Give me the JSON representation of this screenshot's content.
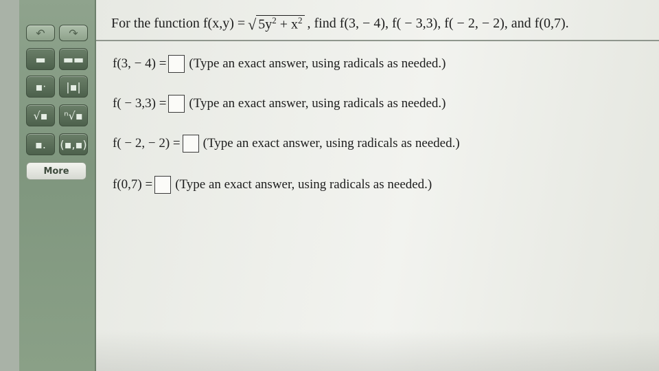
{
  "palette": {
    "rows": [
      [
        "undo-icon",
        "redo-icon"
      ],
      [
        "fraction-icon",
        "mixed-number-icon"
      ],
      [
        "exponent-icon",
        "absolute-value-icon"
      ],
      [
        "square-root-icon",
        "nth-root-icon"
      ],
      [
        "decimal-icon",
        "ordered-pair-icon"
      ]
    ],
    "glyphs": {
      "undo-icon": "↶",
      "redo-icon": "↷",
      "fraction-icon": "▬",
      "mixed-number-icon": "▬▬",
      "exponent-icon": "▪ᐧ",
      "absolute-value-icon": "|▪|",
      "square-root-icon": "√▪",
      "nth-root-icon": "ⁿ√▪",
      "decimal-icon": "▪.",
      "ordered-pair-icon": "(▪,▪)"
    },
    "more_label": "More"
  },
  "problem": {
    "intro": "For the function f(x,y) =",
    "radicand_1": "5y",
    "exp_1": "2",
    "plus": " + x",
    "exp_2": "2",
    "tail": ", find f(3, − 4), f( − 3,3), f( − 2, − 2), and f(0,7)."
  },
  "questions": [
    {
      "label": "f(3, − 4) =",
      "hint": "(Type an exact answer, using radicals as needed.)"
    },
    {
      "label": "f( − 3,3) =",
      "hint": "(Type an exact answer, using radicals as needed.)"
    },
    {
      "label": "f( − 2, − 2) =",
      "hint": "(Type an exact answer, using radicals as needed.)"
    },
    {
      "label": "f(0,7) =",
      "hint": "(Type an exact answer, using radicals as needed.)"
    }
  ]
}
